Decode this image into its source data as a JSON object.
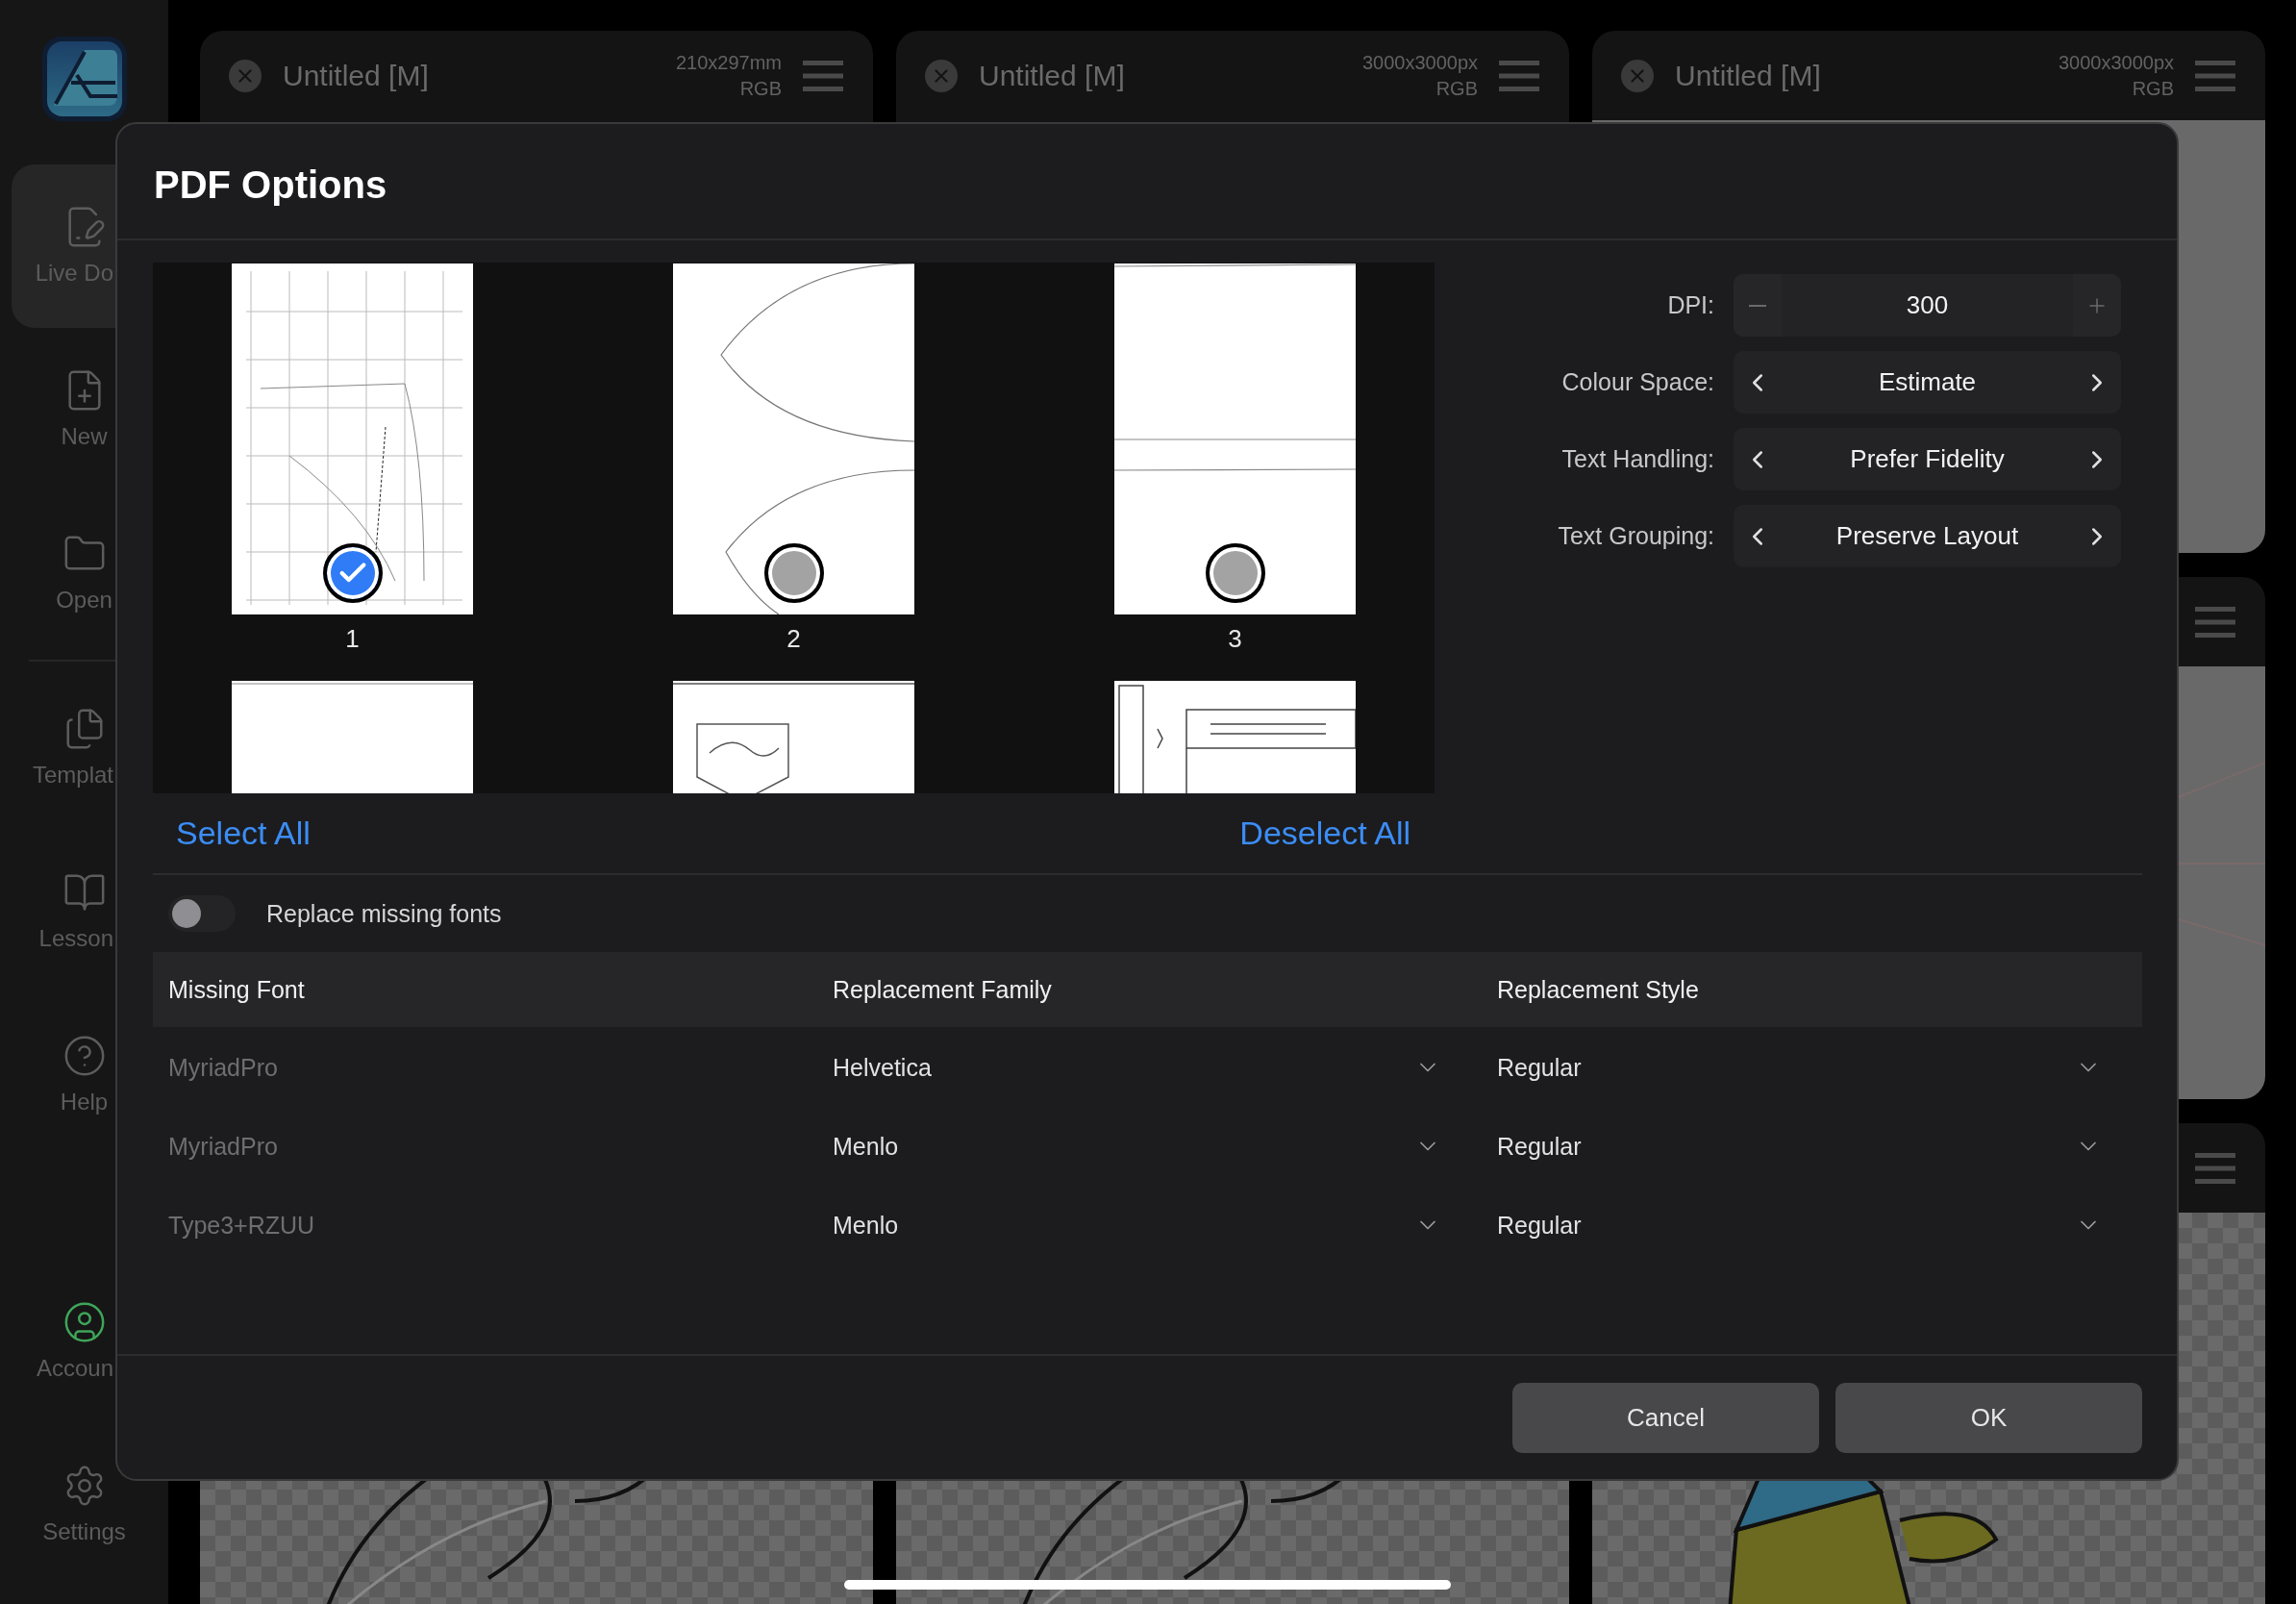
{
  "sidebar": {
    "items": [
      {
        "label": "Live Do",
        "selected": true,
        "cut_off": true
      },
      {
        "label": "New",
        "selected": false,
        "cut_off": false
      },
      {
        "label": "Open",
        "selected": false,
        "cut_off": false
      },
      {
        "label": "Templat",
        "selected": false,
        "cut_off": true
      },
      {
        "label": "Lesson",
        "selected": false,
        "cut_off": true
      },
      {
        "label": "Help",
        "selected": false,
        "cut_off": false
      },
      {
        "label": "Accoun",
        "selected": false,
        "cut_off": true
      },
      {
        "label": "Settings",
        "selected": false,
        "cut_off": false
      }
    ]
  },
  "documents": [
    {
      "title": "Untitled [M]",
      "size": "210x297mm",
      "mode": "RGB"
    },
    {
      "title": "Untitled [M]",
      "size": "3000x3000px",
      "mode": "RGB"
    },
    {
      "title": "Untitled [M]",
      "size": "3000x3000px",
      "mode": "RGB"
    }
  ],
  "dialog": {
    "title": "PDF Options",
    "pages": [
      {
        "label": "1",
        "selected": true
      },
      {
        "label": "2",
        "selected": false
      },
      {
        "label": "3",
        "selected": false
      }
    ],
    "select_all": "Select All",
    "deselect_all": "Deselect All",
    "options": [
      {
        "kind": "stepper",
        "label": "DPI:",
        "value": "300"
      },
      {
        "kind": "cycler",
        "label": "Colour Space:",
        "value": "Estimate"
      },
      {
        "kind": "cycler",
        "label": "Text Handling:",
        "value": "Prefer Fidelity"
      },
      {
        "kind": "cycler",
        "label": "Text Grouping:",
        "value": "Preserve Layout"
      }
    ],
    "replace_fonts": {
      "label": "Replace missing fonts",
      "on": false
    },
    "table": {
      "columns": [
        "Missing Font",
        "Replacement Family",
        "Replacement Style"
      ],
      "rows": [
        {
          "missing": "MyriadPro",
          "family": "Helvetica",
          "style": "Regular"
        },
        {
          "missing": "MyriadPro",
          "family": "Menlo",
          "style": "Regular"
        },
        {
          "missing": "Type3+RZUU",
          "family": "Menlo",
          "style": "Regular"
        }
      ]
    },
    "buttons": [
      {
        "label": "Cancel"
      },
      {
        "label": "OK"
      }
    ]
  }
}
